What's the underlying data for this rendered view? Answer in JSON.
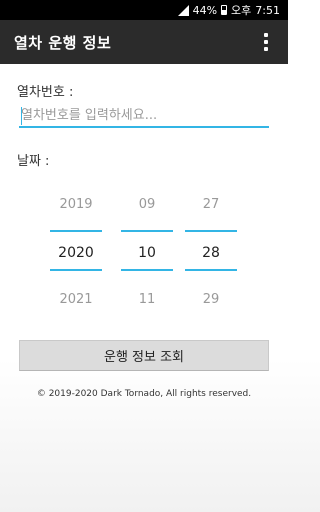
{
  "status_bar": {
    "battery": "44%",
    "period": "오후",
    "time": "7:51"
  },
  "app_bar": {
    "title": "열차 운행 정보"
  },
  "form": {
    "train_label": "열차번호 :",
    "train_placeholder": "열차번호를 입력하세요...",
    "train_value": "",
    "date_label": "날짜 :"
  },
  "date_picker": {
    "year": {
      "prev": "2019",
      "current": "2020",
      "next": "2021"
    },
    "month": {
      "prev": "09",
      "current": "10",
      "next": "11"
    },
    "day": {
      "prev": "27",
      "current": "28",
      "next": "29"
    }
  },
  "actions": {
    "query_label": "운행 정보 조회"
  },
  "footer": {
    "copyright": "© 2019-2020 Dark Tornado, All rights reserved."
  },
  "colors": {
    "accent": "#33b5e5",
    "app_bar": "#2b2b2b",
    "button": "#dcdcdc"
  }
}
